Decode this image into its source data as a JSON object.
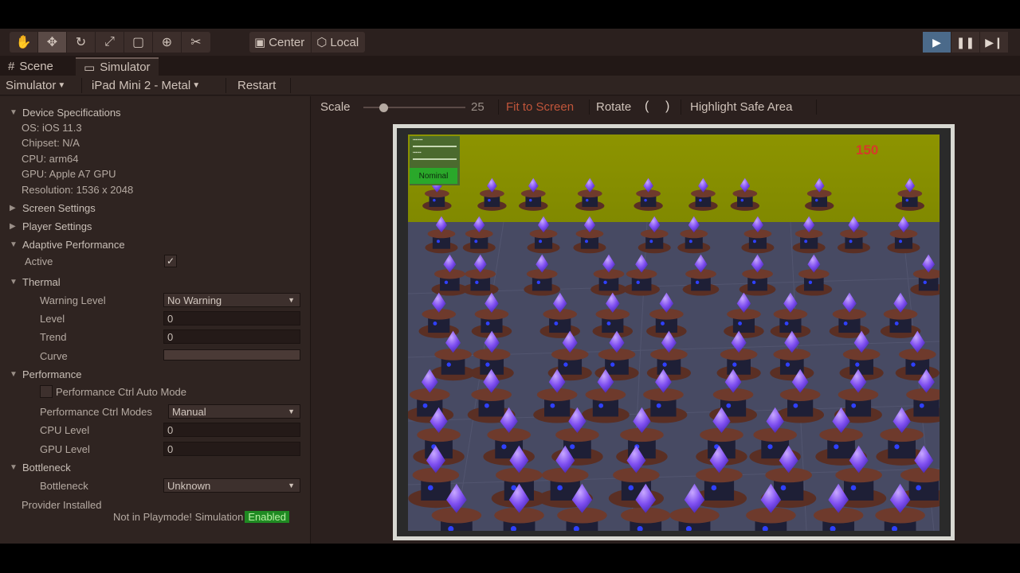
{
  "toolbar": {
    "tools": [
      {
        "icon": "hand-icon"
      },
      {
        "icon": "move-icon"
      },
      {
        "icon": "rotate-icon"
      },
      {
        "icon": "scale-icon"
      },
      {
        "icon": "rect-tool-icon"
      },
      {
        "icon": "transform-icon"
      },
      {
        "icon": "custom-tools-icon"
      }
    ],
    "pivot_center_label": "Center",
    "pivot_local_label": "Local",
    "play_icon": "play-icon",
    "pause_icon": "pause-icon",
    "step_icon": "step-icon"
  },
  "tabs": [
    {
      "label": "Scene",
      "icon": "grid-icon"
    },
    {
      "label": "Simulator",
      "icon": "simulator-icon"
    }
  ],
  "simbar": {
    "mode_label": "Simulator",
    "device_label": "iPad Mini 2 - Metal",
    "restart_label": "Restart"
  },
  "device_specs": {
    "header": "Device Specifications",
    "os": "OS: iOS 11.3",
    "chipset": "Chipset: N/A",
    "cpu": "CPU: arm64",
    "gpu": "GPU: Apple A7 GPU",
    "resolution": "Resolution: 1536 x 2048"
  },
  "sections": {
    "screen_settings": "Screen Settings",
    "player_settings": "Player Settings",
    "adaptive_performance": "Adaptive Performance",
    "active_label": "Active",
    "thermal": "Thermal",
    "performance": "Performance",
    "bottleneck_header": "Bottleneck"
  },
  "thermal": {
    "warning_level_label": "Warning Level",
    "warning_level_value": "No Warning",
    "level_label": "Level",
    "level_value": "0",
    "trend_label": "Trend",
    "trend_value": "0",
    "curve_label": "Curve"
  },
  "performance": {
    "auto_mode_label": "Performance Ctrl Auto Mode",
    "modes_label": "Performance Ctrl Modes",
    "modes_value": "Manual",
    "cpu_level_label": "CPU Level",
    "cpu_level_value": "0",
    "gpu_level_label": "GPU Level",
    "gpu_level_value": "0"
  },
  "bottleneck": {
    "label": "Bottleneck",
    "value": "Unknown"
  },
  "status": {
    "provider_installed": "Provider Installed",
    "playmode_text": "Not in Playmode! Simulation",
    "enabled_badge": "Enabled"
  },
  "sim_controls": {
    "scale_label": "Scale",
    "scale_value": "25",
    "fit_to_screen": "Fit to Screen",
    "rotate_label": "Rotate",
    "rotate_left": "(",
    "rotate_right": ")",
    "highlight_safe_area": "Highlight Safe Area"
  },
  "game": {
    "score": "150",
    "nominal_label": "Nominal"
  },
  "colors": {
    "accent_enabled": "#1f8a22",
    "fit_to_screen_text": "#c0553a",
    "game_sky": "#8a8f00"
  }
}
